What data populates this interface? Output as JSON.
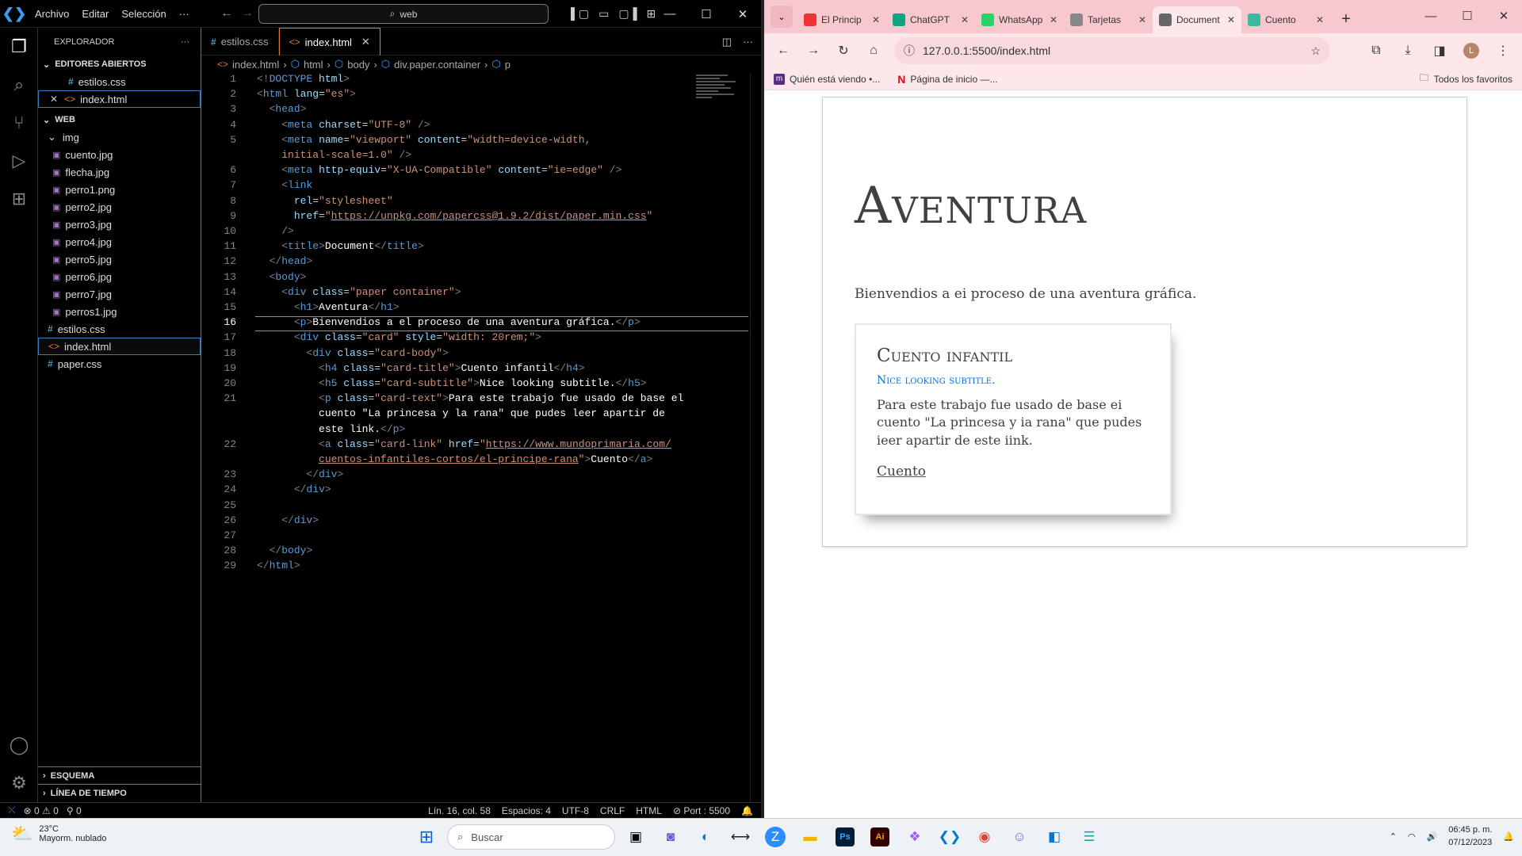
{
  "vscode": {
    "menu": [
      "Archivo",
      "Editar",
      "Selección",
      "···"
    ],
    "command_center": "web",
    "explorer_title": "EXPLORADOR",
    "open_editors_title": "EDITORES ABIERTOS",
    "open_editors": [
      {
        "name": "estilos.css",
        "type": "css"
      },
      {
        "name": "index.html",
        "type": "html"
      }
    ],
    "folder_title": "WEB",
    "tree": [
      {
        "name": "img",
        "type": "folder",
        "depth": 1
      },
      {
        "name": "cuento.jpg",
        "type": "img",
        "depth": 2
      },
      {
        "name": "flecha.jpg",
        "type": "img",
        "depth": 2
      },
      {
        "name": "perro1.png",
        "type": "img",
        "depth": 2
      },
      {
        "name": "perro2.jpg",
        "type": "img",
        "depth": 2
      },
      {
        "name": "perro3.jpg",
        "type": "img",
        "depth": 2
      },
      {
        "name": "perro4.jpg",
        "type": "img",
        "depth": 2
      },
      {
        "name": "perro5.jpg",
        "type": "img",
        "depth": 2
      },
      {
        "name": "perro6.jpg",
        "type": "img",
        "depth": 2
      },
      {
        "name": "perro7.jpg",
        "type": "img",
        "depth": 2
      },
      {
        "name": "perros1.jpg",
        "type": "img",
        "depth": 2
      },
      {
        "name": "estilos.css",
        "type": "css",
        "depth": 1
      },
      {
        "name": "index.html",
        "type": "html",
        "depth": 1,
        "selected": true
      },
      {
        "name": "paper.css",
        "type": "css",
        "depth": 1
      }
    ],
    "outline_title": "ESQUEMA",
    "timeline_title": "LÍNEA DE TIEMPO",
    "tabs": [
      {
        "label": "estilos.css",
        "icon": "#",
        "active": false
      },
      {
        "label": "index.html",
        "icon": "<>",
        "active": true
      }
    ],
    "breadcrumb": [
      "index.html",
      "html",
      "body",
      "div.paper.container",
      "p"
    ],
    "current_line": 16,
    "status": {
      "errors": "0",
      "warnings": "0",
      "ports": "0",
      "position": "Lín. 16, col. 58",
      "spaces": "Espacios: 4",
      "encoding": "UTF-8",
      "eol": "CRLF",
      "language": "HTML",
      "port": "Port : 5500"
    }
  },
  "code_lines": [
    {
      "n": "1",
      "html": "<span class='t'>&lt;!</span><span class='tag'>DOCTYPE</span> <span class='attr'>html</span><span class='t'>&gt;</span>"
    },
    {
      "n": "2",
      "html": "<span class='t'>&lt;</span><span class='tag'>html</span> <span class='attr'>lang</span>=<span class='str'>\"es\"</span><span class='t'>&gt;</span>"
    },
    {
      "n": "3",
      "html": "  <span class='t'>&lt;</span><span class='tag'>head</span><span class='t'>&gt;</span>"
    },
    {
      "n": "4",
      "html": "    <span class='t'>&lt;</span><span class='tag'>meta</span> <span class='attr'>charset</span>=<span class='str'>\"UTF-8\"</span> <span class='t'>/&gt;</span>"
    },
    {
      "n": "5",
      "html": "    <span class='t'>&lt;</span><span class='tag'>meta</span> <span class='attr'>name</span>=<span class='str'>\"viewport\"</span> <span class='attr'>content</span>=<span class='str'>\"width=device-width,</span>"
    },
    {
      "n": "",
      "html": "    <span class='str'>initial-scale=1.0\"</span> <span class='t'>/&gt;</span>"
    },
    {
      "n": "6",
      "html": "    <span class='t'>&lt;</span><span class='tag'>meta</span> <span class='attr'>http-equiv</span>=<span class='str'>\"X-UA-Compatible\"</span> <span class='attr'>content</span>=<span class='str'>\"ie=edge\"</span> <span class='t'>/&gt;</span>"
    },
    {
      "n": "7",
      "html": "    <span class='t'>&lt;</span><span class='tag'>link</span>"
    },
    {
      "n": "8",
      "html": "      <span class='attr'>rel</span>=<span class='str'>\"stylesheet\"</span>"
    },
    {
      "n": "9",
      "html": "      <span class='attr'>href</span>=<span class='str'>\"</span><span class='url'>https://unpkg.com/papercss@1.9.2/dist/paper.min.css</span><span class='str'>\"</span>"
    },
    {
      "n": "10",
      "html": "    <span class='t'>/&gt;</span>"
    },
    {
      "n": "11",
      "html": "    <span class='t'>&lt;</span><span class='tag'>title</span><span class='t'>&gt;</span><span class='txt'>Document</span><span class='t'>&lt;/</span><span class='tag'>title</span><span class='t'>&gt;</span>"
    },
    {
      "n": "12",
      "html": "  <span class='t'>&lt;/</span><span class='tag'>head</span><span class='t'>&gt;</span>"
    },
    {
      "n": "13",
      "html": "  <span class='t'>&lt;</span><span class='tag'>body</span><span class='t'>&gt;</span>"
    },
    {
      "n": "14",
      "html": "    <span class='t'>&lt;</span><span class='tag'>div</span> <span class='attr'>class</span>=<span class='str'>\"paper container\"</span><span class='t'>&gt;</span>"
    },
    {
      "n": "15",
      "html": "      <span class='t'>&lt;</span><span class='tag'>h1</span><span class='t'>&gt;</span><span class='txt'>Aventura</span><span class='t'>&lt;/</span><span class='tag'>h1</span><span class='t'>&gt;</span>"
    },
    {
      "n": "16",
      "html": "      <span class='t'>&lt;</span><span class='tag'>p</span><span class='t'>&gt;</span><span class='txt'>Bienvendios a el proceso de una aventura gráfica.</span><span class='t'>&lt;/</span><span class='tag'>p</span><span class='t'>&gt;</span>"
    },
    {
      "n": "17",
      "html": "      <span class='t'>&lt;</span><span class='tag'>div</span> <span class='attr'>class</span>=<span class='str'>\"card\"</span> <span class='attr'>style</span>=<span class='str'>\"width: 20rem;\"</span><span class='t'>&gt;</span>"
    },
    {
      "n": "18",
      "html": "        <span class='t'>&lt;</span><span class='tag'>div</span> <span class='attr'>class</span>=<span class='str'>\"card-body\"</span><span class='t'>&gt;</span>"
    },
    {
      "n": "19",
      "html": "          <span class='t'>&lt;</span><span class='tag'>h4</span> <span class='attr'>class</span>=<span class='str'>\"card-title\"</span><span class='t'>&gt;</span><span class='txt'>Cuento infantil</span><span class='t'>&lt;/</span><span class='tag'>h4</span><span class='t'>&gt;</span>"
    },
    {
      "n": "20",
      "html": "          <span class='t'>&lt;</span><span class='tag'>h5</span> <span class='attr'>class</span>=<span class='str'>\"card-subtitle\"</span><span class='t'>&gt;</span><span class='txt'>Nice looking subtitle.</span><span class='t'>&lt;/</span><span class='tag'>h5</span><span class='t'>&gt;</span>"
    },
    {
      "n": "21",
      "html": "          <span class='t'>&lt;</span><span class='tag'>p</span> <span class='attr'>class</span>=<span class='str'>\"card-text\"</span><span class='t'>&gt;</span><span class='txt'>Para este trabajo fue usado de base el</span>"
    },
    {
      "n": "",
      "html": "          <span class='txt'>cuento \"La princesa y la rana\" que pudes leer apartir de</span>"
    },
    {
      "n": "",
      "html": "          <span class='txt'>este link.</span><span class='t'>&lt;/</span><span class='tag'>p</span><span class='t'>&gt;</span>"
    },
    {
      "n": "22",
      "html": "          <span class='t'>&lt;</span><span class='tag'>a</span> <span class='attr'>class</span>=<span class='str'>\"card-link\"</span> <span class='attr'>href</span>=<span class='str'>\"</span><span class='url'>https://www.mundoprimaria.com/</span>"
    },
    {
      "n": "",
      "html": "          <span class='url'>cuentos-infantiles-cortos/el-principe-rana</span><span class='str'>\"</span><span class='t'>&gt;</span><span class='txt'>Cuento</span><span class='t'>&lt;/</span><span class='tag'>a</span><span class='t'>&gt;</span>"
    },
    {
      "n": "23",
      "html": "        <span class='t'>&lt;/</span><span class='tag'>div</span><span class='t'>&gt;</span>"
    },
    {
      "n": "24",
      "html": "      <span class='t'>&lt;/</span><span class='tag'>div</span><span class='t'>&gt;</span>"
    },
    {
      "n": "25",
      "html": ""
    },
    {
      "n": "26",
      "html": "    <span class='t'>&lt;/</span><span class='tag'>div</span><span class='t'>&gt;</span>"
    },
    {
      "n": "27",
      "html": ""
    },
    {
      "n": "28",
      "html": "  <span class='t'>&lt;/</span><span class='tag'>body</span><span class='t'>&gt;</span>"
    },
    {
      "n": "29",
      "html": "<span class='t'>&lt;/</span><span class='tag'>html</span><span class='t'>&gt;</span>"
    }
  ],
  "chrome": {
    "tabs": [
      {
        "title": "El Princip",
        "favicon_color": "#e33",
        "active": false
      },
      {
        "title": "ChatGPT",
        "favicon_color": "#10a37f",
        "active": false
      },
      {
        "title": "WhatsApp",
        "favicon_color": "#25d366",
        "active": false
      },
      {
        "title": "Tarjetas",
        "favicon_color": "#888",
        "active": false
      },
      {
        "title": "Document",
        "favicon_color": "#666",
        "active": true
      },
      {
        "title": "Cuento",
        "favicon_color": "#3cb8a0",
        "active": false
      }
    ],
    "url": "127.0.0.1:5500/index.html",
    "profile_initial": "L",
    "bookmarks": [
      {
        "label": "Quién está viendo •...",
        "icon": "m",
        "color": "#5a2d82"
      },
      {
        "label": "Página de inicio —...",
        "icon": "N",
        "color": "#e50914"
      }
    ],
    "all_bookmarks": "Todos los favoritos"
  },
  "page": {
    "h1": "Aventura",
    "intro": "Bienvendios a ei proceso de una aventura gráfica.",
    "card_title": "Cuento infantil",
    "card_subtitle": "Nice looking subtitle.",
    "card_text": "Para este trabajo fue usado de base ei cuento \"La princesa y ia rana\" que pudes ieer apartir de este iink.",
    "card_link": "Cuento"
  },
  "taskbar": {
    "temp": "23°C",
    "weather": "Mayorm. nublado",
    "search_placeholder": "Buscar",
    "time": "06:45 p. m.",
    "date": "07/12/2023"
  }
}
